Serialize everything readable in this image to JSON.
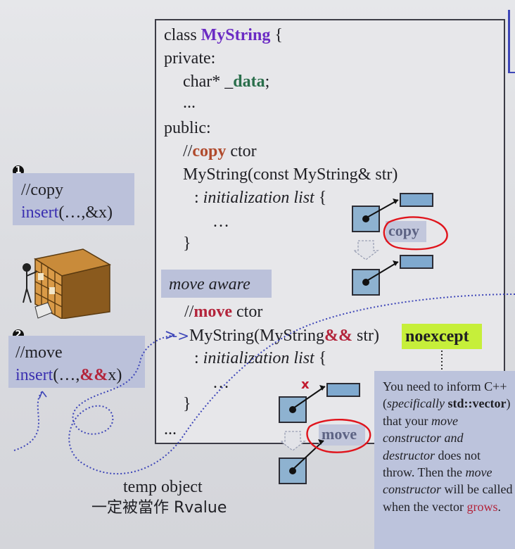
{
  "code": {
    "l1": {
      "kw": "class ",
      "name": "MyString",
      "brace": " {"
    },
    "l2": "private:",
    "l3": {
      "pre": "char* _",
      "data": "data",
      "post": ";"
    },
    "l4": "...",
    "l5": "public:",
    "l6": {
      "slashes": "//",
      "copy": "copy",
      "rest": " ctor"
    },
    "l7": "MyString(const MyString& str)",
    "l8": {
      "colon": ": ",
      "italic": "initialization list",
      "brace": " {"
    },
    "l9": "…",
    "l10": "}",
    "move_aware": "move aware",
    "l12": {
      "slashes": "//",
      "move": "move",
      "rest": " ctor"
    },
    "l13": {
      "arrow": "->",
      "pre": "MyString(MyString",
      "amp": "&&",
      "post": " str)"
    },
    "noexcept": "noexcept",
    "l14": {
      "colon": ": ",
      "italic": "initialization list",
      "brace": " {"
    },
    "l15": "…",
    "l16": "}",
    "l17": "..."
  },
  "diagram": {
    "copy_label": "copy",
    "move_label": "move",
    "x_mark": "x"
  },
  "left": {
    "badge1": "1",
    "copy_comment": "//copy",
    "copy_insert": {
      "fn": "insert",
      "args": "(…,&x)"
    },
    "badge2": "2",
    "move_comment": "//move",
    "move_insert": {
      "fn": "insert",
      "args_pre": "(…,",
      "amp": "&&",
      "args_post": "x)"
    }
  },
  "bottom": {
    "line1": "temp object",
    "line2": "一定被當作 Rvalue"
  },
  "note": {
    "t1": "You need to inform C++ (",
    "t2": "specifically",
    "t3": " ",
    "t4": "std::vector",
    "t5": ") that your ",
    "t6": "move constructor and destructor",
    "t7": " does not throw. Then the ",
    "t8": "move constructor",
    "t9": " will be called when the vector ",
    "t10": "grows",
    "t11": "."
  },
  "colors": {
    "accent_purple": "#6b2bc4",
    "green": "#2a6e4b",
    "red": "#b3243b",
    "highlight": "#c6ef3a",
    "note_bg": "#bcc3dc",
    "annotation_red": "#e0141c",
    "link_blue": "#3e46b8"
  }
}
